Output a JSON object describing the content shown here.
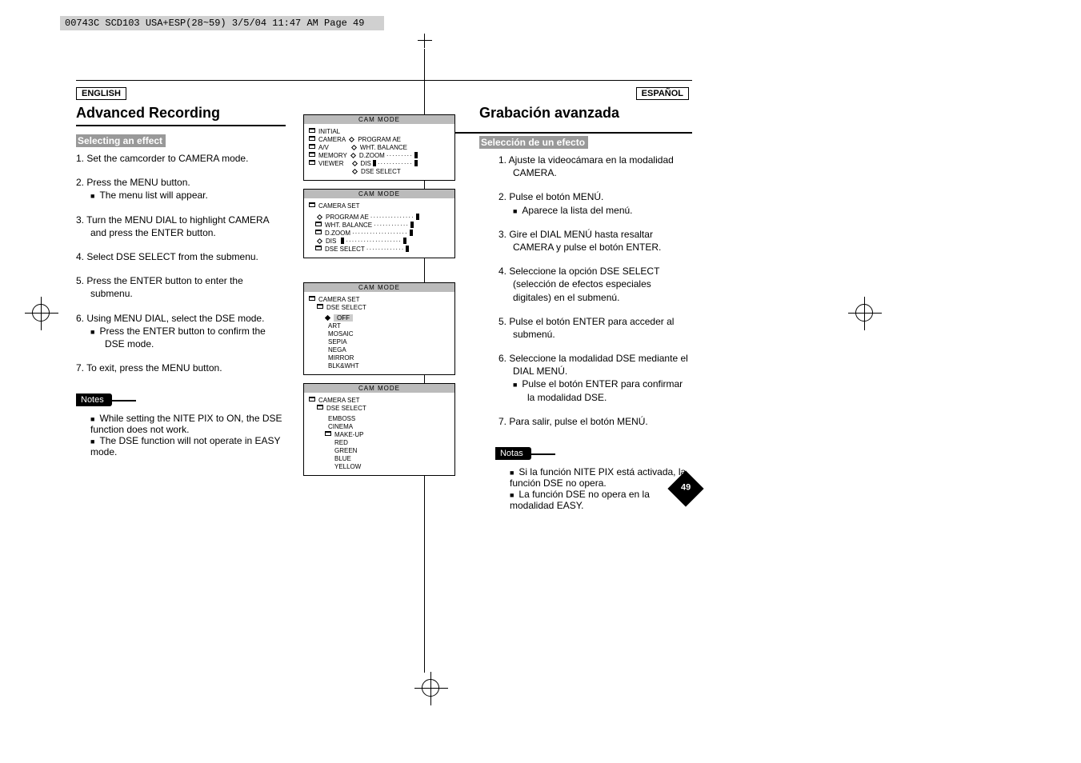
{
  "print": {
    "header": "00743C SCD103 USA+ESP(28~59)  3/5/04 11:47 AM  Page 49"
  },
  "page_number": "49",
  "left": {
    "lang": "ENGLISH",
    "title": "Advanced Recording",
    "section": "Selecting an effect",
    "steps": {
      "s1": "1.  Set the camcorder to CAMERA mode.",
      "s2": "2.  Press the MENU button.",
      "s2b": "The menu list will appear.",
      "s3": "3.  Turn the MENU DIAL to highlight CAMERA and press the ENTER button.",
      "s4": "4.  Select DSE SELECT from the submenu.",
      "s5": "5.  Press the ENTER button to enter the submenu.",
      "s6": "6.  Using MENU DIAL, select the DSE mode.",
      "s6b": "Press the ENTER button to confirm the DSE mode.",
      "s7": "7.  To exit, press the MENU button."
    },
    "notes_label": "Notes",
    "notes": {
      "n1": "While setting the NITE PIX to ON, the DSE function does not work.",
      "n2": "The DSE function will not operate in EASY mode."
    }
  },
  "right": {
    "lang": "ESPAÑOL",
    "title": "Grabación avanzada",
    "section": "Selección de un efecto",
    "steps": {
      "s1": "1.  Ajuste la videocámara en la modalidad CAMERA.",
      "s2": "2.  Pulse el botón MENÚ.",
      "s2b": "Aparece la lista del menú.",
      "s3": "3.  Gire el DIAL MENÚ hasta resaltar CAMERA y pulse el botón ENTER.",
      "s4": "4.  Seleccione la opción DSE SELECT (selección de efectos especiales digitales) en el submenú.",
      "s5": "5.  Pulse el botón ENTER para acceder al submenú.",
      "s6": "6.  Seleccione la modalidad DSE mediante el DIAL MENÚ.",
      "s6b": "Pulse el botón ENTER para confirmar la modalidad DSE.",
      "s7": "7.  Para salir, pulse el botón MENÚ."
    },
    "notes_label": "Notas",
    "notes": {
      "n1": "Si la función NITE PIX está activada, la función DSE no opera.",
      "n2": "La función DSE no opera en la modalidad EASY."
    }
  },
  "screens": {
    "mode": "CAM  MODE",
    "s1": {
      "initial": "INITIAL",
      "camera": "CAMERA",
      "av": "A/V",
      "memory": "MEMORY",
      "viewer": "VIEWER",
      "r1": "PROGRAM AE",
      "r2": "WHT. BALANCE",
      "r3": "D.ZOOM",
      "r4": "DIS",
      "r5": "DSE SELECT"
    },
    "s2": {
      "heading": "CAMERA SET",
      "r1": "PROGRAM AE",
      "r2": "WHT. BALANCE",
      "r3": "D.ZOOM",
      "r4": "DIS",
      "r5": "DSE SELECT"
    },
    "s3": {
      "h1": "CAMERA SET",
      "h2": "DSE SELECT",
      "o0": "OFF",
      "o1": "ART",
      "o2": "MOSAIC",
      "o3": "SEPIA",
      "o4": "NEGA",
      "o5": "MIRROR",
      "o6": "BLK&WHT"
    },
    "s4": {
      "h1": "CAMERA SET",
      "h2": "DSE SELECT",
      "o1": "EMBOSS",
      "o2": "CINEMA",
      "o3": "MAKE-UP",
      "o4": "RED",
      "o5": "GREEN",
      "o6": "BLUE",
      "o7": "YELLOW"
    }
  }
}
